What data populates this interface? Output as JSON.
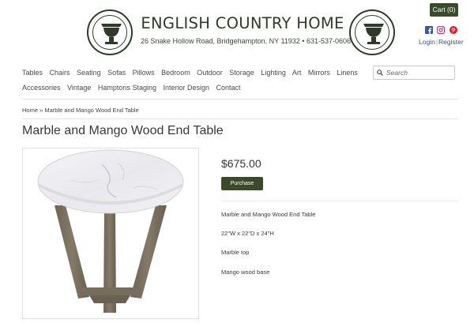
{
  "brand": {
    "name": "ENGLISH COUNTRY HOME",
    "address": "26 Snake Hollow Road, Bridgehampton, NY 11932 • 631-537-0606",
    "seal_text": "ENGLISH COUNTRY ANTIQUES • HOME FURNISHINGS"
  },
  "header": {
    "cart_label": "Cart (0)",
    "login_label": "Login",
    "separator": "|",
    "register_label": "Register",
    "social_icons": [
      "facebook-icon",
      "instagram-icon",
      "pinterest-icon"
    ],
    "social_colors": {
      "facebook": "#3b5998",
      "instagram": "#c13584",
      "pinterest": "#cb2027"
    }
  },
  "nav": {
    "row1": [
      "Tables",
      "Chairs",
      "Seating",
      "Sofas",
      "Pillows",
      "Bedroom",
      "Outdoor",
      "Storage",
      "Lighting",
      "Art",
      "Mirrors",
      "Linens"
    ],
    "row2": [
      "Accessories",
      "Vintage",
      "Hamptons Staging",
      "Interior Design",
      "Contact"
    ]
  },
  "search": {
    "placeholder": "Search"
  },
  "breadcrumb": {
    "home": "Home",
    "sep": "»",
    "current": "Marble and Mango Wood End Table"
  },
  "product": {
    "title": "Marble and Mango Wood End Table",
    "price": "$675.00",
    "purchase_label": "Purchase",
    "description": [
      "Marble and Mango Wood End Table",
      "22\"W x 22\"D x 24\"H",
      "Marble top",
      "Mango wood base"
    ]
  },
  "colors": {
    "accent": "#3b4a2b",
    "brand_text": "#2f3a2a",
    "link": "#3a4f7a"
  }
}
